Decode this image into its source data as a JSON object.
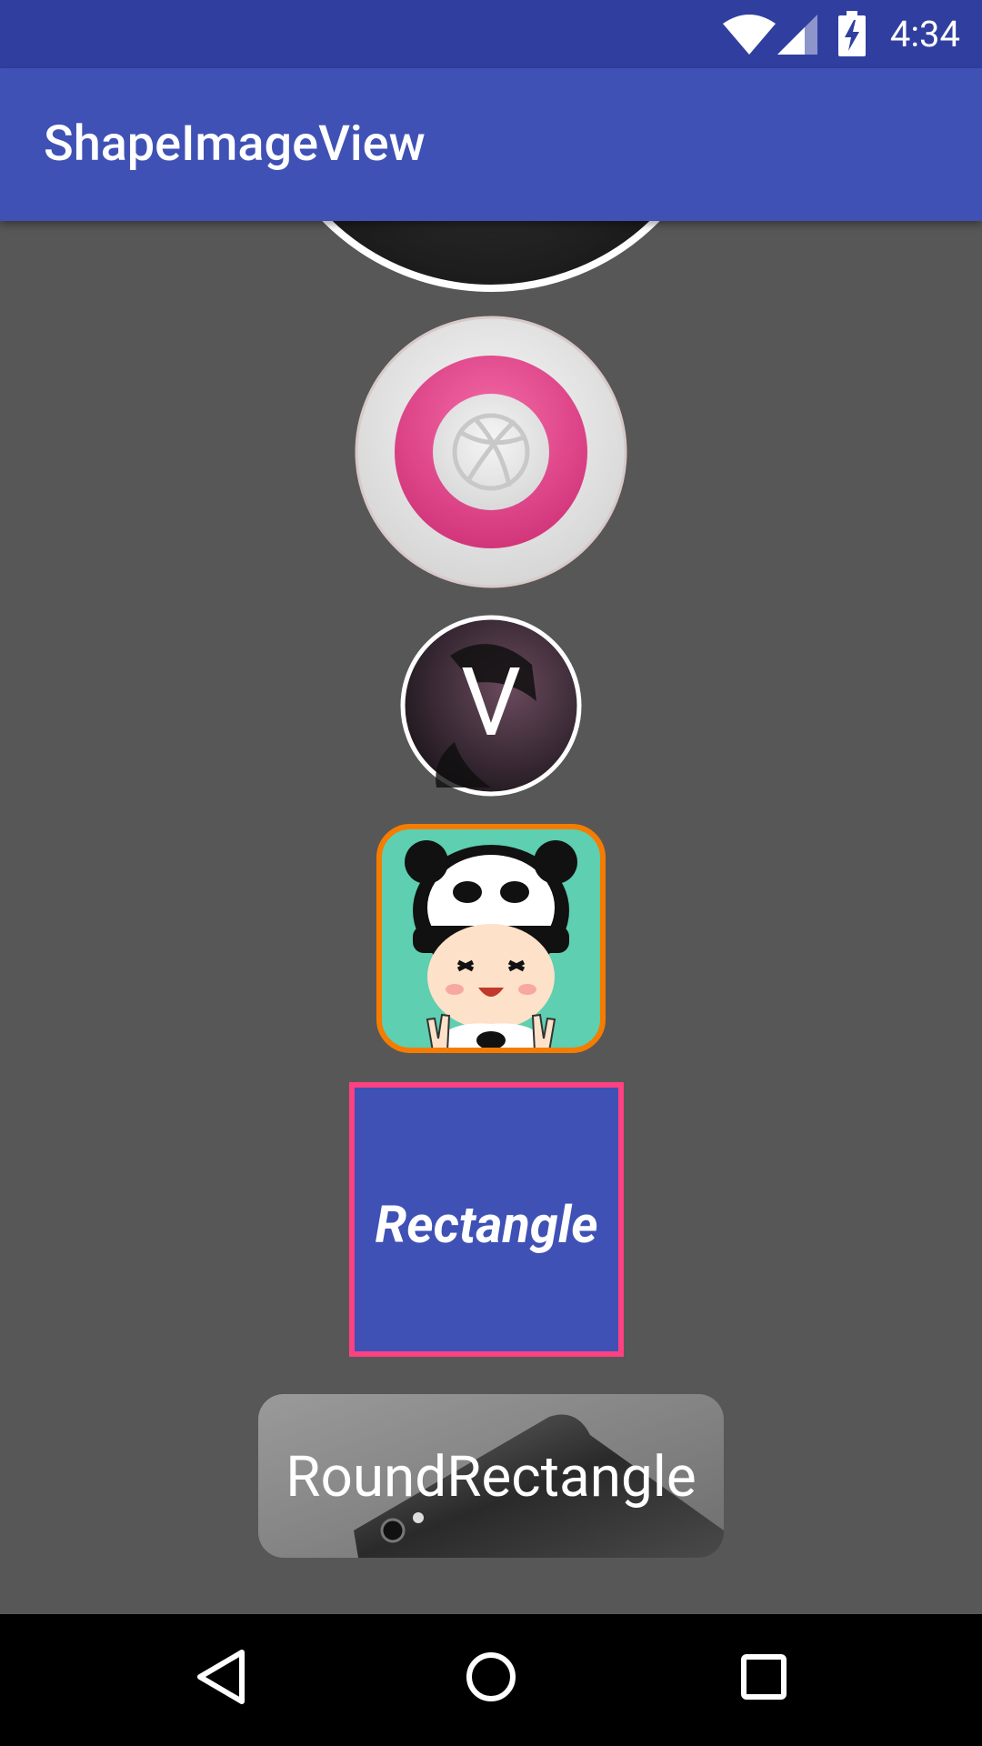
{
  "status_bar": {
    "time": "4:34",
    "icons": [
      "wifi-icon",
      "signal-icon",
      "battery-charging-icon"
    ]
  },
  "app_bar": {
    "title": "ShapeImageView"
  },
  "shapes": {
    "circle_avatar_text": "V",
    "rectangle_label": "Rectangle",
    "round_rectangle_label": "RoundRectangle"
  },
  "colors": {
    "status_bar": "#303F9F",
    "app_bar": "#3F51B5",
    "background": "#575757",
    "rectangle_fill": "#3F51B5",
    "rectangle_border": "#FF4081",
    "square_border": "#F57C00",
    "square_bg": "#5ECFB0",
    "dribbble_pink": "#EA4C89"
  },
  "nav_bar": {
    "icons": [
      "back-icon",
      "home-icon",
      "recents-icon"
    ]
  }
}
